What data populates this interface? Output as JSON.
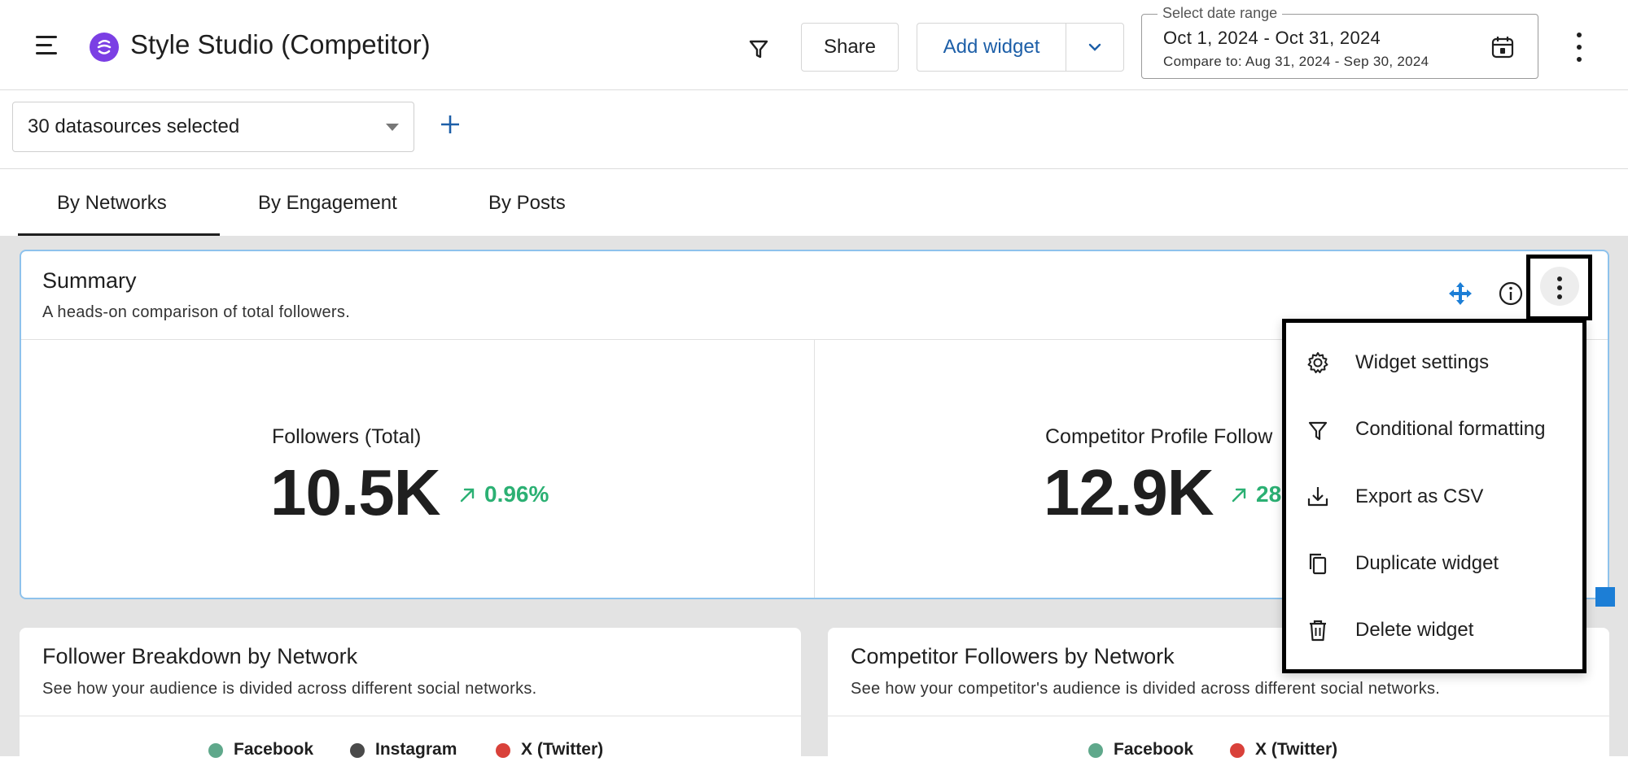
{
  "header": {
    "title": "Style Studio (Competitor)",
    "share_label": "Share",
    "add_widget_label": "Add widget",
    "date_range": {
      "legend": "Select date range",
      "range": "Oct 1, 2024 - Oct 31, 2024",
      "compare": "Compare to: Aug 31, 2024 - Sep 30, 2024"
    }
  },
  "datasources": {
    "selected_label": "30 datasources selected"
  },
  "tabs": [
    {
      "label": "By Networks",
      "active": true
    },
    {
      "label": "By Engagement",
      "active": false
    },
    {
      "label": "By Posts",
      "active": false
    }
  ],
  "summary": {
    "title": "Summary",
    "subtitle": "A heads-on comparison of total followers.",
    "metrics": [
      {
        "label": "Followers (Total)",
        "value": "10.5K",
        "change": "0.96%"
      },
      {
        "label": "Competitor Profile Follow",
        "value": "12.9K",
        "change": "28"
      }
    ]
  },
  "menu": {
    "items": [
      {
        "label": "Widget settings",
        "icon": "gear-icon"
      },
      {
        "label": "Conditional formatting",
        "icon": "filter-icon"
      },
      {
        "label": "Export as CSV",
        "icon": "download-icon"
      },
      {
        "label": "Duplicate widget",
        "icon": "copy-icon"
      },
      {
        "label": "Delete widget",
        "icon": "trash-icon"
      }
    ]
  },
  "cards": [
    {
      "title": "Follower Breakdown by Network",
      "subtitle": "See how your audience is divided across different social networks.",
      "legend": [
        {
          "label": "Facebook",
          "color": "#5fa88b"
        },
        {
          "label": "Instagram",
          "color": "#4a4a4a"
        },
        {
          "label": "X (Twitter)",
          "color": "#d9413a"
        }
      ]
    },
    {
      "title": "Competitor Followers by Network",
      "subtitle": "See how your competitor's audience is divided across different social networks.",
      "legend": [
        {
          "label": "Facebook",
          "color": "#5fa88b"
        },
        {
          "label": "X (Twitter)",
          "color": "#d9413a"
        }
      ]
    }
  ],
  "colors": {
    "accent": "#1d5fa8",
    "positive": "#2bb073",
    "brand": "#7b3fe4",
    "selected_border": "#8ec2ec"
  }
}
